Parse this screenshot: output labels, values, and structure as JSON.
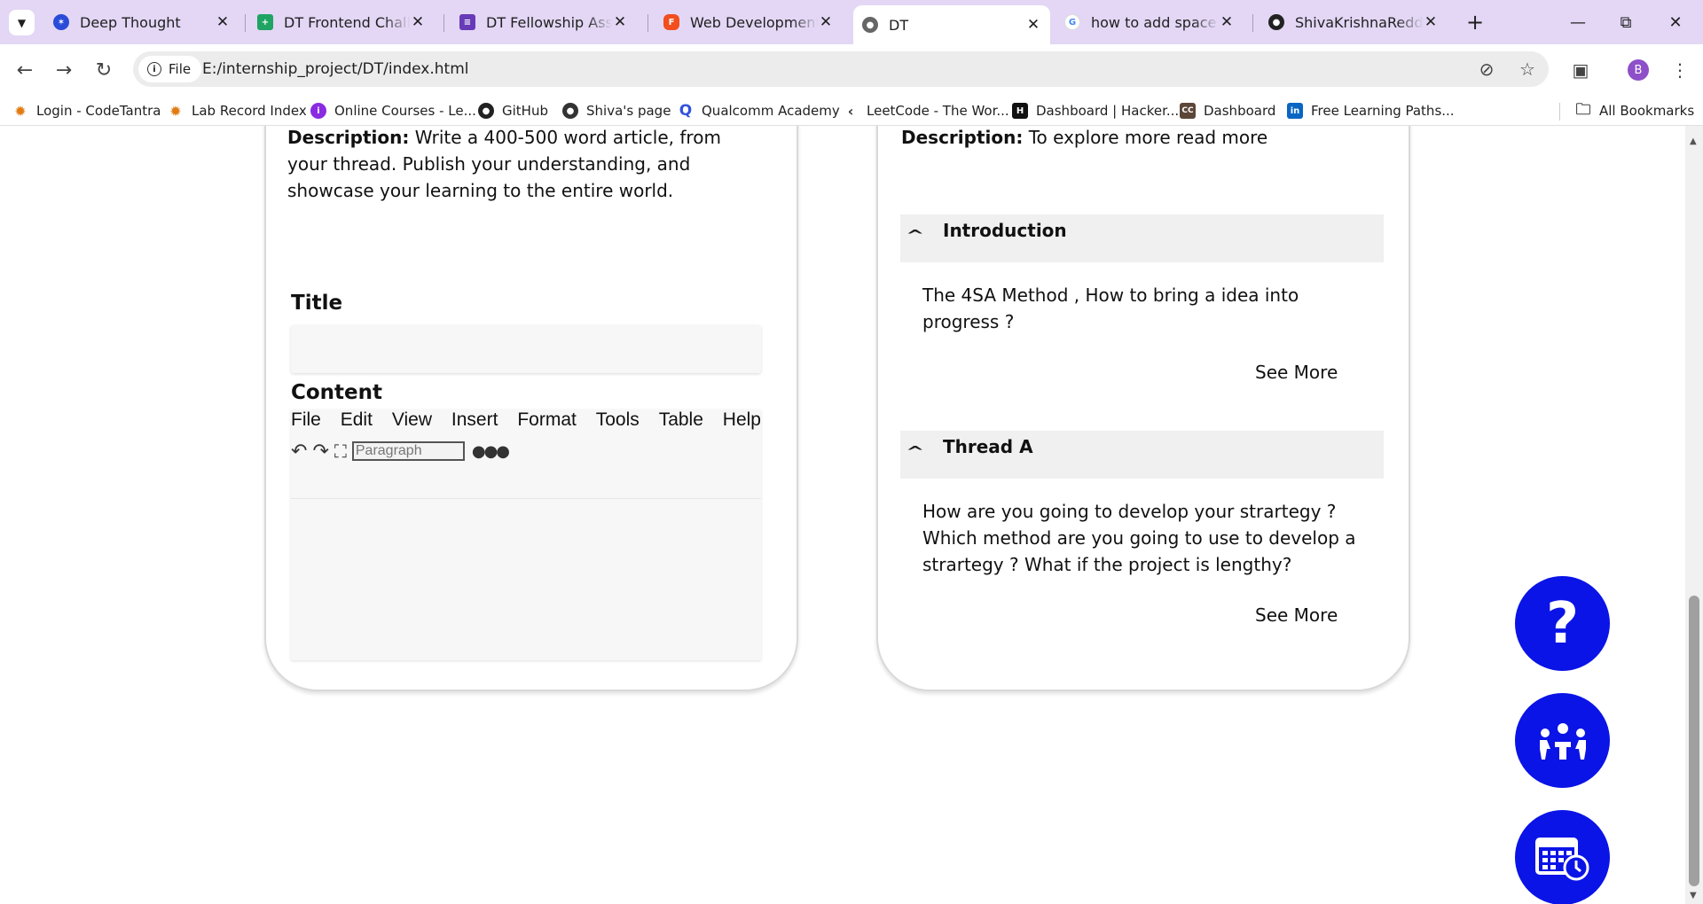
{
  "tabs": [
    {
      "title": "Deep Thought",
      "icon": "deep-thought-icon"
    },
    {
      "title": "DT Frontend Challenge",
      "icon": "sheets-icon"
    },
    {
      "title": "DT Fellowship Assignment",
      "icon": "forms-icon"
    },
    {
      "title": "Web Development Academy",
      "icon": "figma-icon"
    },
    {
      "title": "DT",
      "icon": "globe-icon"
    },
    {
      "title": "how to add space in",
      "icon": "google-icon"
    },
    {
      "title": "ShivaKrishnaReddyBu",
      "icon": "github-icon"
    }
  ],
  "toolbar": {
    "chip_label": "File",
    "url": "E:/internship_project/DT/index.html",
    "profile_initial": "B"
  },
  "bookmarks": [
    {
      "label": "Login - CodeTantra",
      "icon": "codetantra-icon"
    },
    {
      "label": "Lab Record Index",
      "icon": "codetantra-icon"
    },
    {
      "label": "Online Courses - Le...",
      "icon": "udemy-icon"
    },
    {
      "label": "GitHub",
      "icon": "github-icon"
    },
    {
      "label": "Shiva's page",
      "icon": "globe-icon"
    },
    {
      "label": "Qualcomm Academy",
      "icon": "qualcomm-icon"
    },
    {
      "label": "LeetCode - The Wor...",
      "icon": "leetcode-icon"
    },
    {
      "label": "Dashboard | Hacker...",
      "icon": "hackerrank-icon"
    },
    {
      "label": "Dashboard",
      "icon": "cc-icon"
    },
    {
      "label": "Free Learning Paths...",
      "icon": "linkedin-icon"
    }
  ],
  "all_bookmarks": "All Bookmarks",
  "left_card": {
    "desc_label": "Description:",
    "desc_text": "Write a 400-500 word article, from your thread. Publish your understanding, and showcase your learning to the entire world.",
    "title_label": "Title",
    "content_label": "Content",
    "menu": [
      "File",
      "Edit",
      "View",
      "Insert",
      "Format",
      "Tools",
      "Table",
      "Help"
    ],
    "paragraph_select": "Paragraph"
  },
  "right_card": {
    "desc_label": "Description:",
    "desc_text": "To explore more read more",
    "sections": [
      {
        "heading": "Introduction",
        "body": "The 4SA Method , How to bring a idea into progress ?",
        "link": "See More"
      },
      {
        "heading": "Thread A",
        "body": "How are you going to develop your strartegy ? Which method are you going to use to develop a strartegy ? What if the project is lengthy?",
        "link": "See More"
      }
    ]
  },
  "colors": {
    "fab_blue": "#0a14e6",
    "tabstrip": "#e3d7f5"
  }
}
